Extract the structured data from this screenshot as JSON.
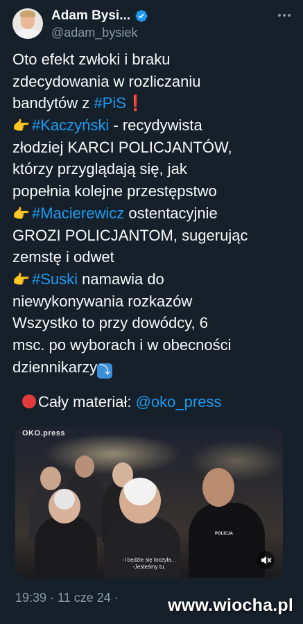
{
  "header": {
    "name": "Adam Bysi...",
    "handle": "@adam_bysiek"
  },
  "tweet": {
    "l1": "Oto efekt zwłoki i braku",
    "l2": "zdecydowania w rozliczaniu",
    "l3_text": "bandytów z ",
    "l3_tag": "#PiS",
    "l3_mark": "❗",
    "l4_icon": "👉",
    "l4_tag": "#Kaczyński",
    "l4_text": " - recydywista",
    "l5": "złodziej KARCI POLICJANTÓW,",
    "l6": "którzy przyglądają się, jak",
    "l7": "popełnia kolejne przestępstwo",
    "l8_icon": "👉",
    "l8_tag": "#Macierewicz",
    "l8_text": " ostentacyjnie",
    "l9": "GROZI POLICJANTOM, sugerując",
    "l10": "zemstę i odwet",
    "l11_icon": "👉",
    "l11_tag": "#Suski",
    "l11_text": " namawia do",
    "l12": "niewykonywania rozkazów",
    "l13": "Wszystko to przy dowódcy, 6",
    "l14": "msc. po wyborach i w obecności",
    "l15": "dziennikarzy",
    "l15_emoji": "⤵"
  },
  "material": {
    "text": "Cały materiał: ",
    "link": "@oko_press"
  },
  "video": {
    "watermark": "OKO.press",
    "subtitle_1": "-I będzie się toczyła...",
    "subtitle_2": "-Jesteśmy tu.",
    "police_label": "POLICJA"
  },
  "footer": {
    "timestamp": "19:39 · 11 cze 24 ·"
  },
  "site_watermark": "www.wiocha.pl",
  "colors": {
    "background": "#15202b",
    "link": "#1d9bf0",
    "secondary_text": "#8b98a5"
  }
}
